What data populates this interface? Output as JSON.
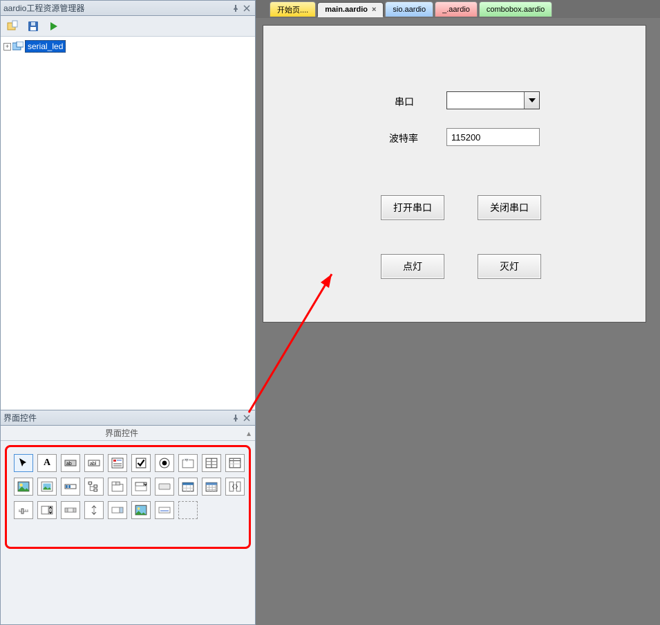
{
  "projectPanel": {
    "title": "aardio工程资源管理器",
    "treeRoot": "serial_led"
  },
  "controlsPanel": {
    "title": "界面控件",
    "tabLabel": "界面控件"
  },
  "tabs": [
    {
      "label": "开始页....",
      "style": "yellow",
      "closable": false
    },
    {
      "label": "main.aardio",
      "style": "active",
      "closable": true
    },
    {
      "label": "sio.aardio",
      "style": "blue",
      "closable": false
    },
    {
      "label": "_.aardio",
      "style": "red",
      "closable": false
    },
    {
      "label": "combobox.aardio",
      "style": "green",
      "closable": false
    }
  ],
  "form": {
    "labels": {
      "port": "串口",
      "baud": "波特率"
    },
    "baudValue": "115200",
    "buttons": {
      "open": "打开串口",
      "close": "关闭串口",
      "on": "点灯",
      "off": "灭灯"
    }
  }
}
